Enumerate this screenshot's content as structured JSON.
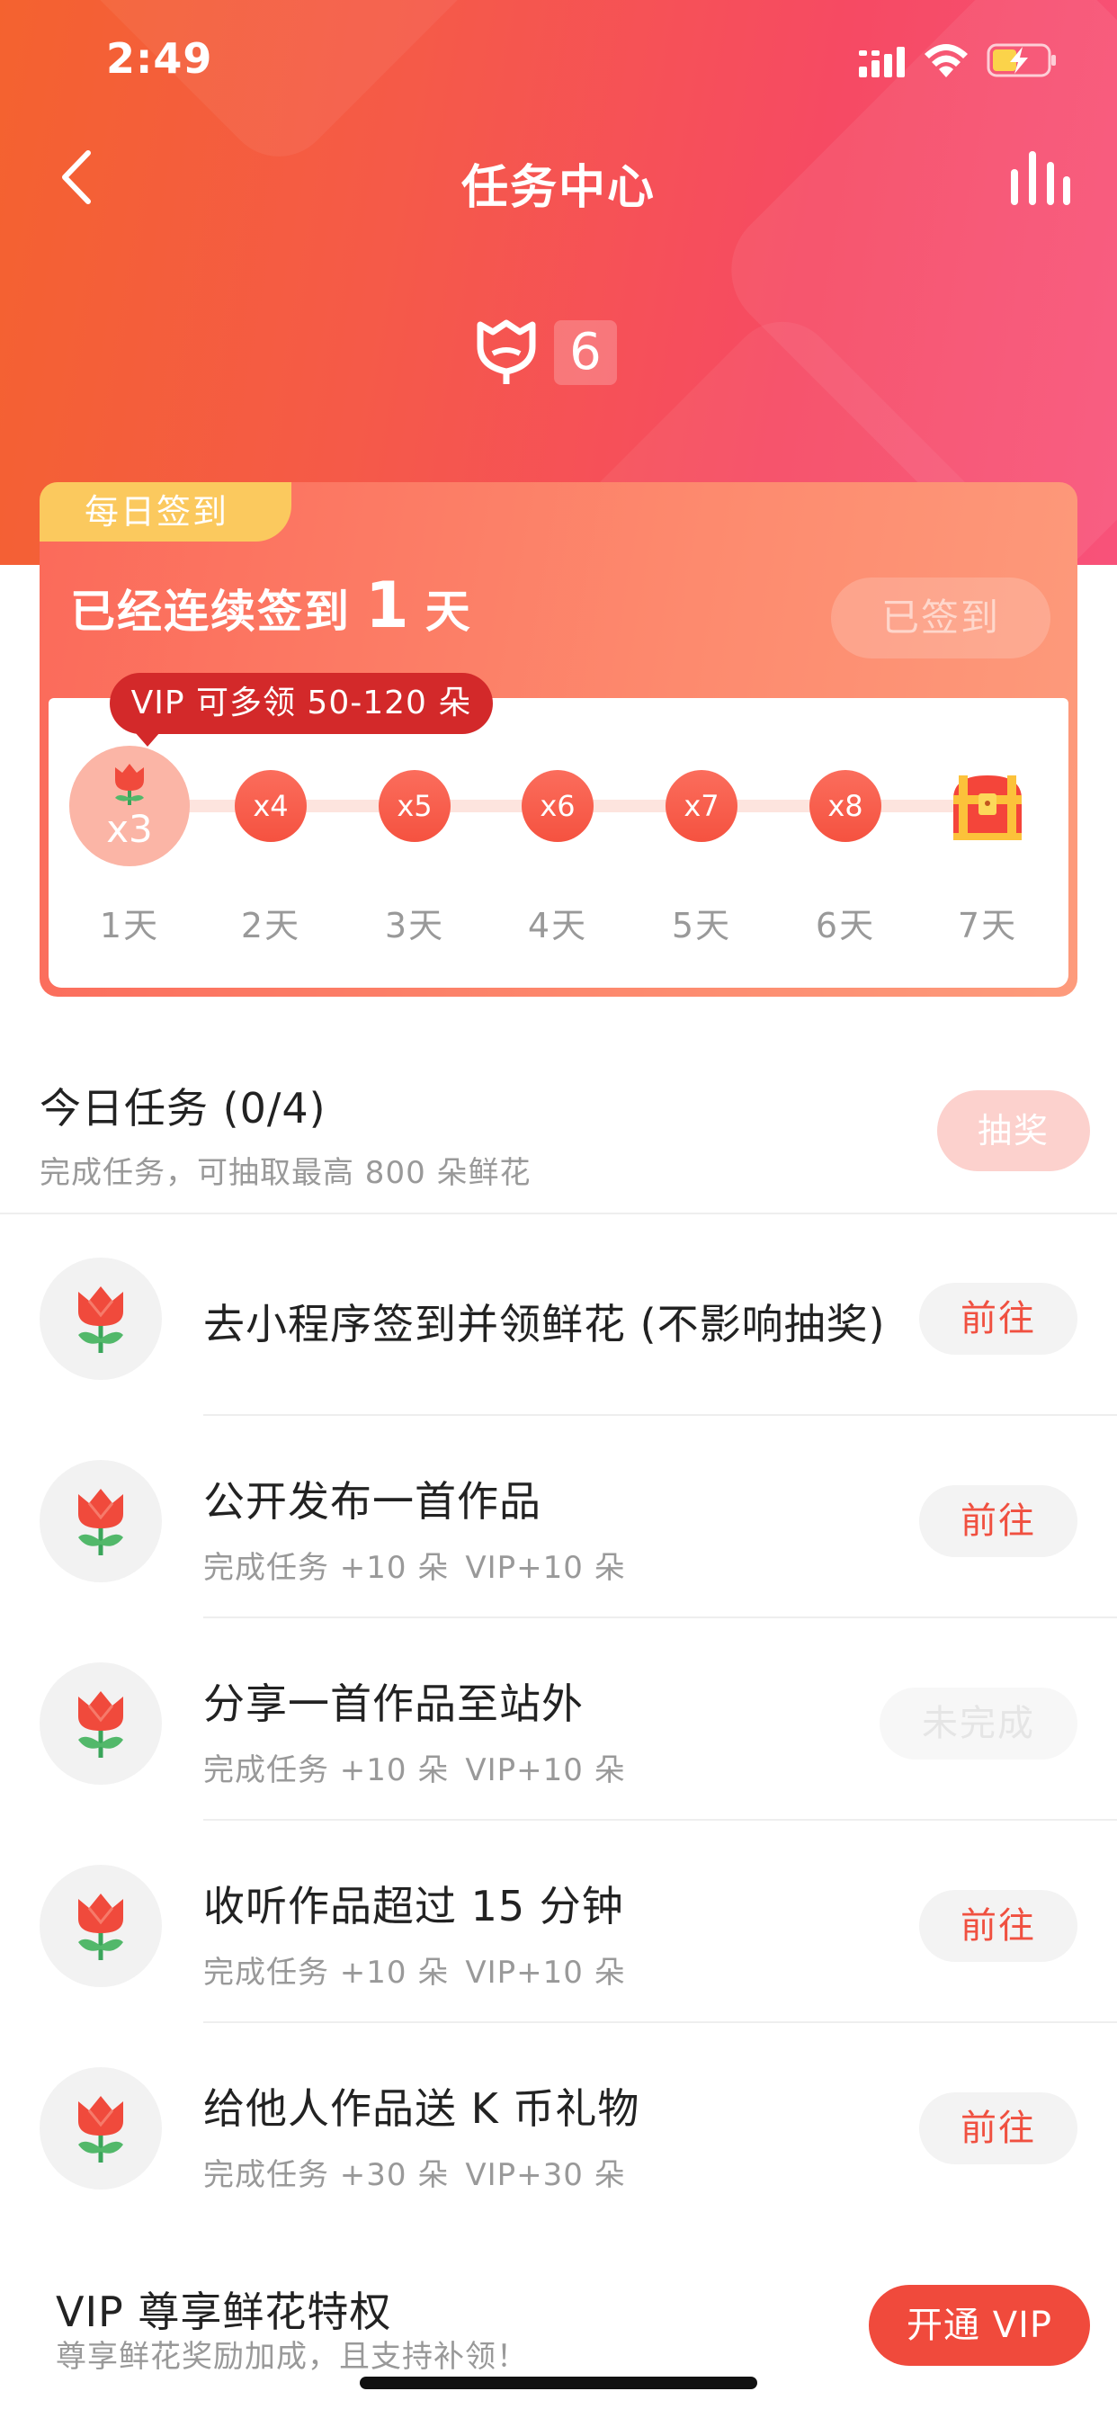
{
  "status_bar": {
    "time": "2:49"
  },
  "nav": {
    "title": "任务中心"
  },
  "flowers": {
    "count": "6"
  },
  "signin": {
    "tag": "每日签到",
    "streak_prefix": "已经连续签到",
    "streak_days": "1",
    "streak_suffix": "天",
    "button": "已签到",
    "vip_tip": "VIP 可多领 50-120 朵",
    "days": [
      {
        "label": "1天",
        "multiplier": "x3",
        "today": true
      },
      {
        "label": "2天",
        "multiplier": "x4"
      },
      {
        "label": "3天",
        "multiplier": "x5"
      },
      {
        "label": "4天",
        "multiplier": "x6"
      },
      {
        "label": "5天",
        "multiplier": "x7"
      },
      {
        "label": "6天",
        "multiplier": "x8"
      },
      {
        "label": "7天",
        "icon": "treasure-chest-icon"
      }
    ]
  },
  "tasks": {
    "title": "今日任务 (0/4)",
    "subtitle": "完成任务，可抽取最高 800 朵鲜花",
    "lottery_button": "抽奖",
    "items": [
      {
        "name": "去小程序签到并领鲜花 (不影响抽奖)",
        "button": "前往"
      },
      {
        "name": "公开发布一首作品",
        "reward": "完成任务 +10 朵",
        "vip_reward": "VIP+10 朵",
        "button": "前往"
      },
      {
        "name": "分享一首作品至站外",
        "reward": "完成任务 +10 朵",
        "vip_reward": "VIP+10 朵",
        "button": "未完成"
      },
      {
        "name": "收听作品超过 15 分钟",
        "reward": "完成任务 +10 朵",
        "vip_reward": "VIP+10 朵",
        "button": "前往"
      },
      {
        "name": "给他人作品送 K 币礼物",
        "reward": "完成任务 +30 朵",
        "vip_reward": "VIP+30 朵",
        "button": "前往"
      }
    ]
  },
  "vip_banner": {
    "title": "VIP 尊享鲜花特权",
    "subtitle": "尊享鲜花奖励加成，且支持补领！",
    "button": "开通 VIP"
  },
  "colors": {
    "accent": "#f04a3c",
    "vip_tag": "#fbc95e",
    "vip_bubble": "#d3292a"
  }
}
